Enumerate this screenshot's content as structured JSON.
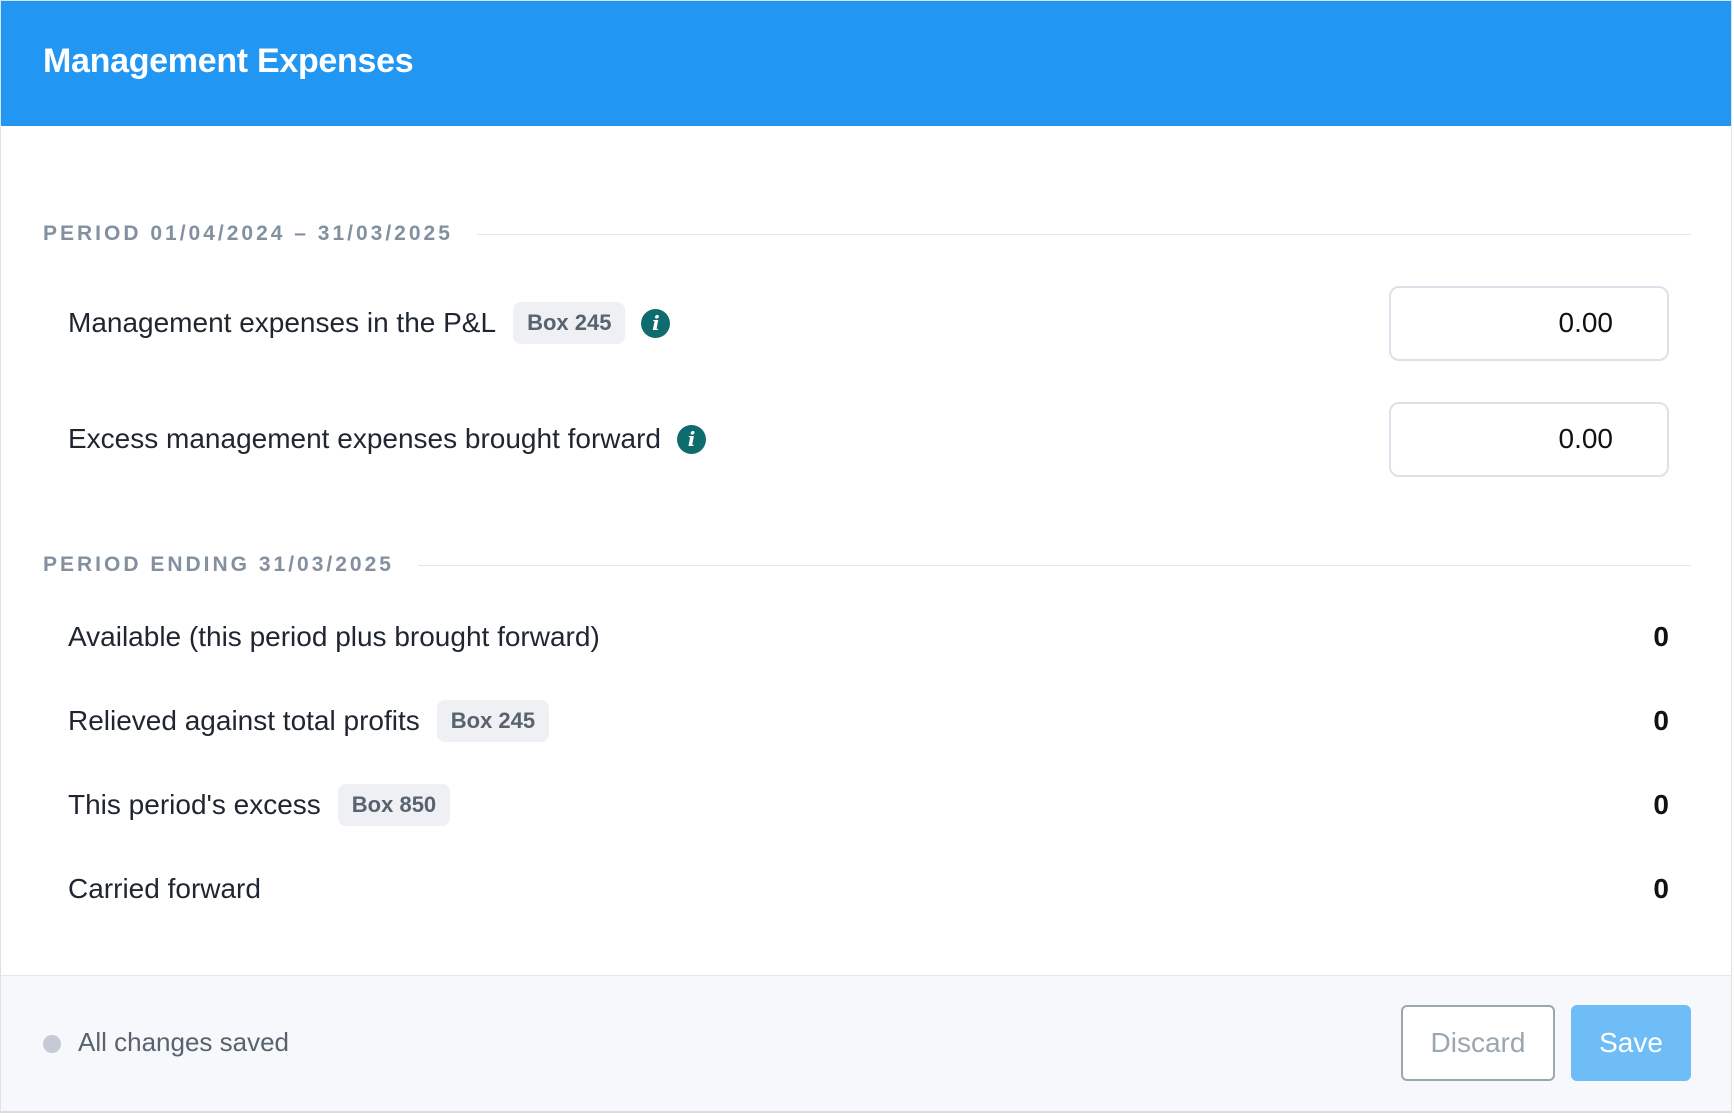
{
  "header": {
    "title": "Management Expenses"
  },
  "period_section": {
    "heading": "PERIOD 01/04/2024 – 31/03/2025",
    "rows": [
      {
        "label": "Management expenses in the P&L",
        "badge": "Box 245",
        "value": "0.00"
      },
      {
        "label": "Excess management expenses brought forward",
        "value": "0.00"
      }
    ]
  },
  "ending_section": {
    "heading": "PERIOD ENDING 31/03/2025",
    "rows": [
      {
        "label": "Available (this period plus brought forward)",
        "value": "0"
      },
      {
        "label": "Relieved against total profits",
        "badge": "Box 245",
        "value": "0"
      },
      {
        "label": "This period's excess",
        "badge": "Box 850",
        "value": "0"
      },
      {
        "label": "Carried forward",
        "value": "0"
      }
    ]
  },
  "info_icon_glyph": "i",
  "footer": {
    "status": "All changes saved",
    "discard_label": "Discard",
    "save_label": "Save"
  },
  "icons": {
    "info": "info-icon",
    "status": "status-dot-icon"
  },
  "colors": {
    "header_bg": "#2196f3",
    "info_icon": "#0e6b6e",
    "save_button": "#6fbdf7",
    "discard_border": "#9aa7b0"
  }
}
